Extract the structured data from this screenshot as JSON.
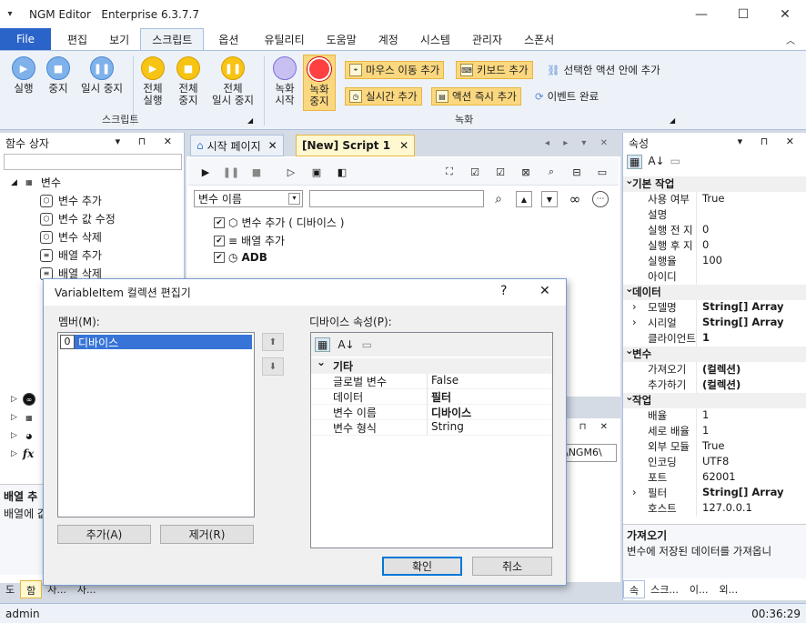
{
  "window": {
    "app_name": "NGM Editor",
    "edition": "Enterprise 6.3.7.7"
  },
  "menubar": {
    "file": "File",
    "tabs": [
      "편집",
      "보기",
      "스크립트",
      "옵션",
      "유틸리티",
      "도움말",
      "계정",
      "시스템",
      "관리자",
      "스폰서"
    ],
    "active_tab": "스크립트"
  },
  "ribbon": {
    "script_group": {
      "label": "스크립트",
      "run": "실행",
      "stop": "중지",
      "pause": "일시 중지",
      "run_all": [
        "전체",
        "실행"
      ],
      "stop_all": [
        "전체",
        "중지"
      ],
      "pause_all": [
        "전체",
        "일시 중지"
      ]
    },
    "record_group": {
      "label": "녹화",
      "rec_start": [
        "녹화",
        "시작"
      ],
      "rec_stop": [
        "녹화",
        "중지"
      ],
      "mouse_move": "마우스 이동 추가",
      "keyboard": "키보드 추가",
      "add_in_selected": "선택한 액션 안에 추가",
      "realtime": "실시간 추가",
      "action_now": "액션 즉시 추가",
      "event_done": "이벤트 완료"
    }
  },
  "left_panel": {
    "title": "함수 상자",
    "tree_root": "변수",
    "tree_items": [
      "변수 추가",
      "변수 값 수정",
      "변수 삭제",
      "배열 추가",
      "배열 삭제"
    ],
    "desc_title": "배열 추",
    "desc_text": "배열에 값",
    "bottom_tabs": [
      "도",
      "함",
      "사...",
      "사..."
    ]
  },
  "editor": {
    "tabs": [
      "시작 페이지",
      "[New] Script 1"
    ],
    "search_dropdown": "변수 이름",
    "search_value": "",
    "lines": [
      "변수 추가 ( 디바이스 )",
      "배열 추가",
      "ADB"
    ],
    "bottom_path": "\\NGM6\\"
  },
  "right_panel": {
    "title": "속성",
    "rows": [
      {
        "cat": true,
        "k": "기본 작업"
      },
      {
        "k": "사용 여부",
        "v": "True"
      },
      {
        "k": "설명",
        "v": ""
      },
      {
        "k": "실행 전 지",
        "v": "0"
      },
      {
        "k": "실행 후 지",
        "v": "0"
      },
      {
        "k": "실행율",
        "v": "100"
      },
      {
        "k": "아이디",
        "v": ""
      },
      {
        "cat": true,
        "k": "데이터"
      },
      {
        "k": "모델명",
        "v": "String[] Array",
        "bold": true,
        "exp": true
      },
      {
        "k": "시리얼",
        "v": "String[] Array",
        "bold": true,
        "exp": true
      },
      {
        "k": "클라이언트",
        "v": "1",
        "bold": true
      },
      {
        "cat": true,
        "k": "변수"
      },
      {
        "k": "가져오기",
        "v": "(컬렉션)",
        "bold": true
      },
      {
        "k": "추가하기",
        "v": "(컬렉션)",
        "bold": true
      },
      {
        "cat": true,
        "k": "작업"
      },
      {
        "k": "배율",
        "v": "1"
      },
      {
        "k": "세로 배율",
        "v": "1"
      },
      {
        "k": "외부 모듈",
        "v": "True"
      },
      {
        "k": "인코딩",
        "v": "UTF8"
      },
      {
        "k": "포트",
        "v": "62001"
      },
      {
        "k": "필터",
        "v": "String[] Array",
        "bold": true,
        "exp": true
      },
      {
        "k": "호스트",
        "v": "127.0.0.1"
      }
    ],
    "desc_title": "가져오기",
    "desc_text": "변수에 저장된 데이터를 가져옵니",
    "bottom_tabs": [
      "속",
      "스크...",
      "이...",
      "외..."
    ]
  },
  "status": {
    "user": "admin",
    "time": "00:36:29"
  },
  "dialog": {
    "title": "VariableItem 컬렉션 편집기",
    "help": "?",
    "members_label": "멤버(M):",
    "props_label": "디바이스 속성(P):",
    "member_index": "0",
    "member_name": "디바이스",
    "add_button": "추가(A)",
    "remove_button": "제거(R)",
    "ok_button": "확인",
    "cancel_button": "취소",
    "prop_rows": [
      {
        "cat": true,
        "k": "기타"
      },
      {
        "k": "글로벌 변수",
        "v": "False"
      },
      {
        "k": "데이터",
        "v": "필터",
        "bold": true
      },
      {
        "k": "변수 이름",
        "v": "디바이스",
        "bold": true
      },
      {
        "k": "변수 형식",
        "v": "String"
      }
    ]
  }
}
